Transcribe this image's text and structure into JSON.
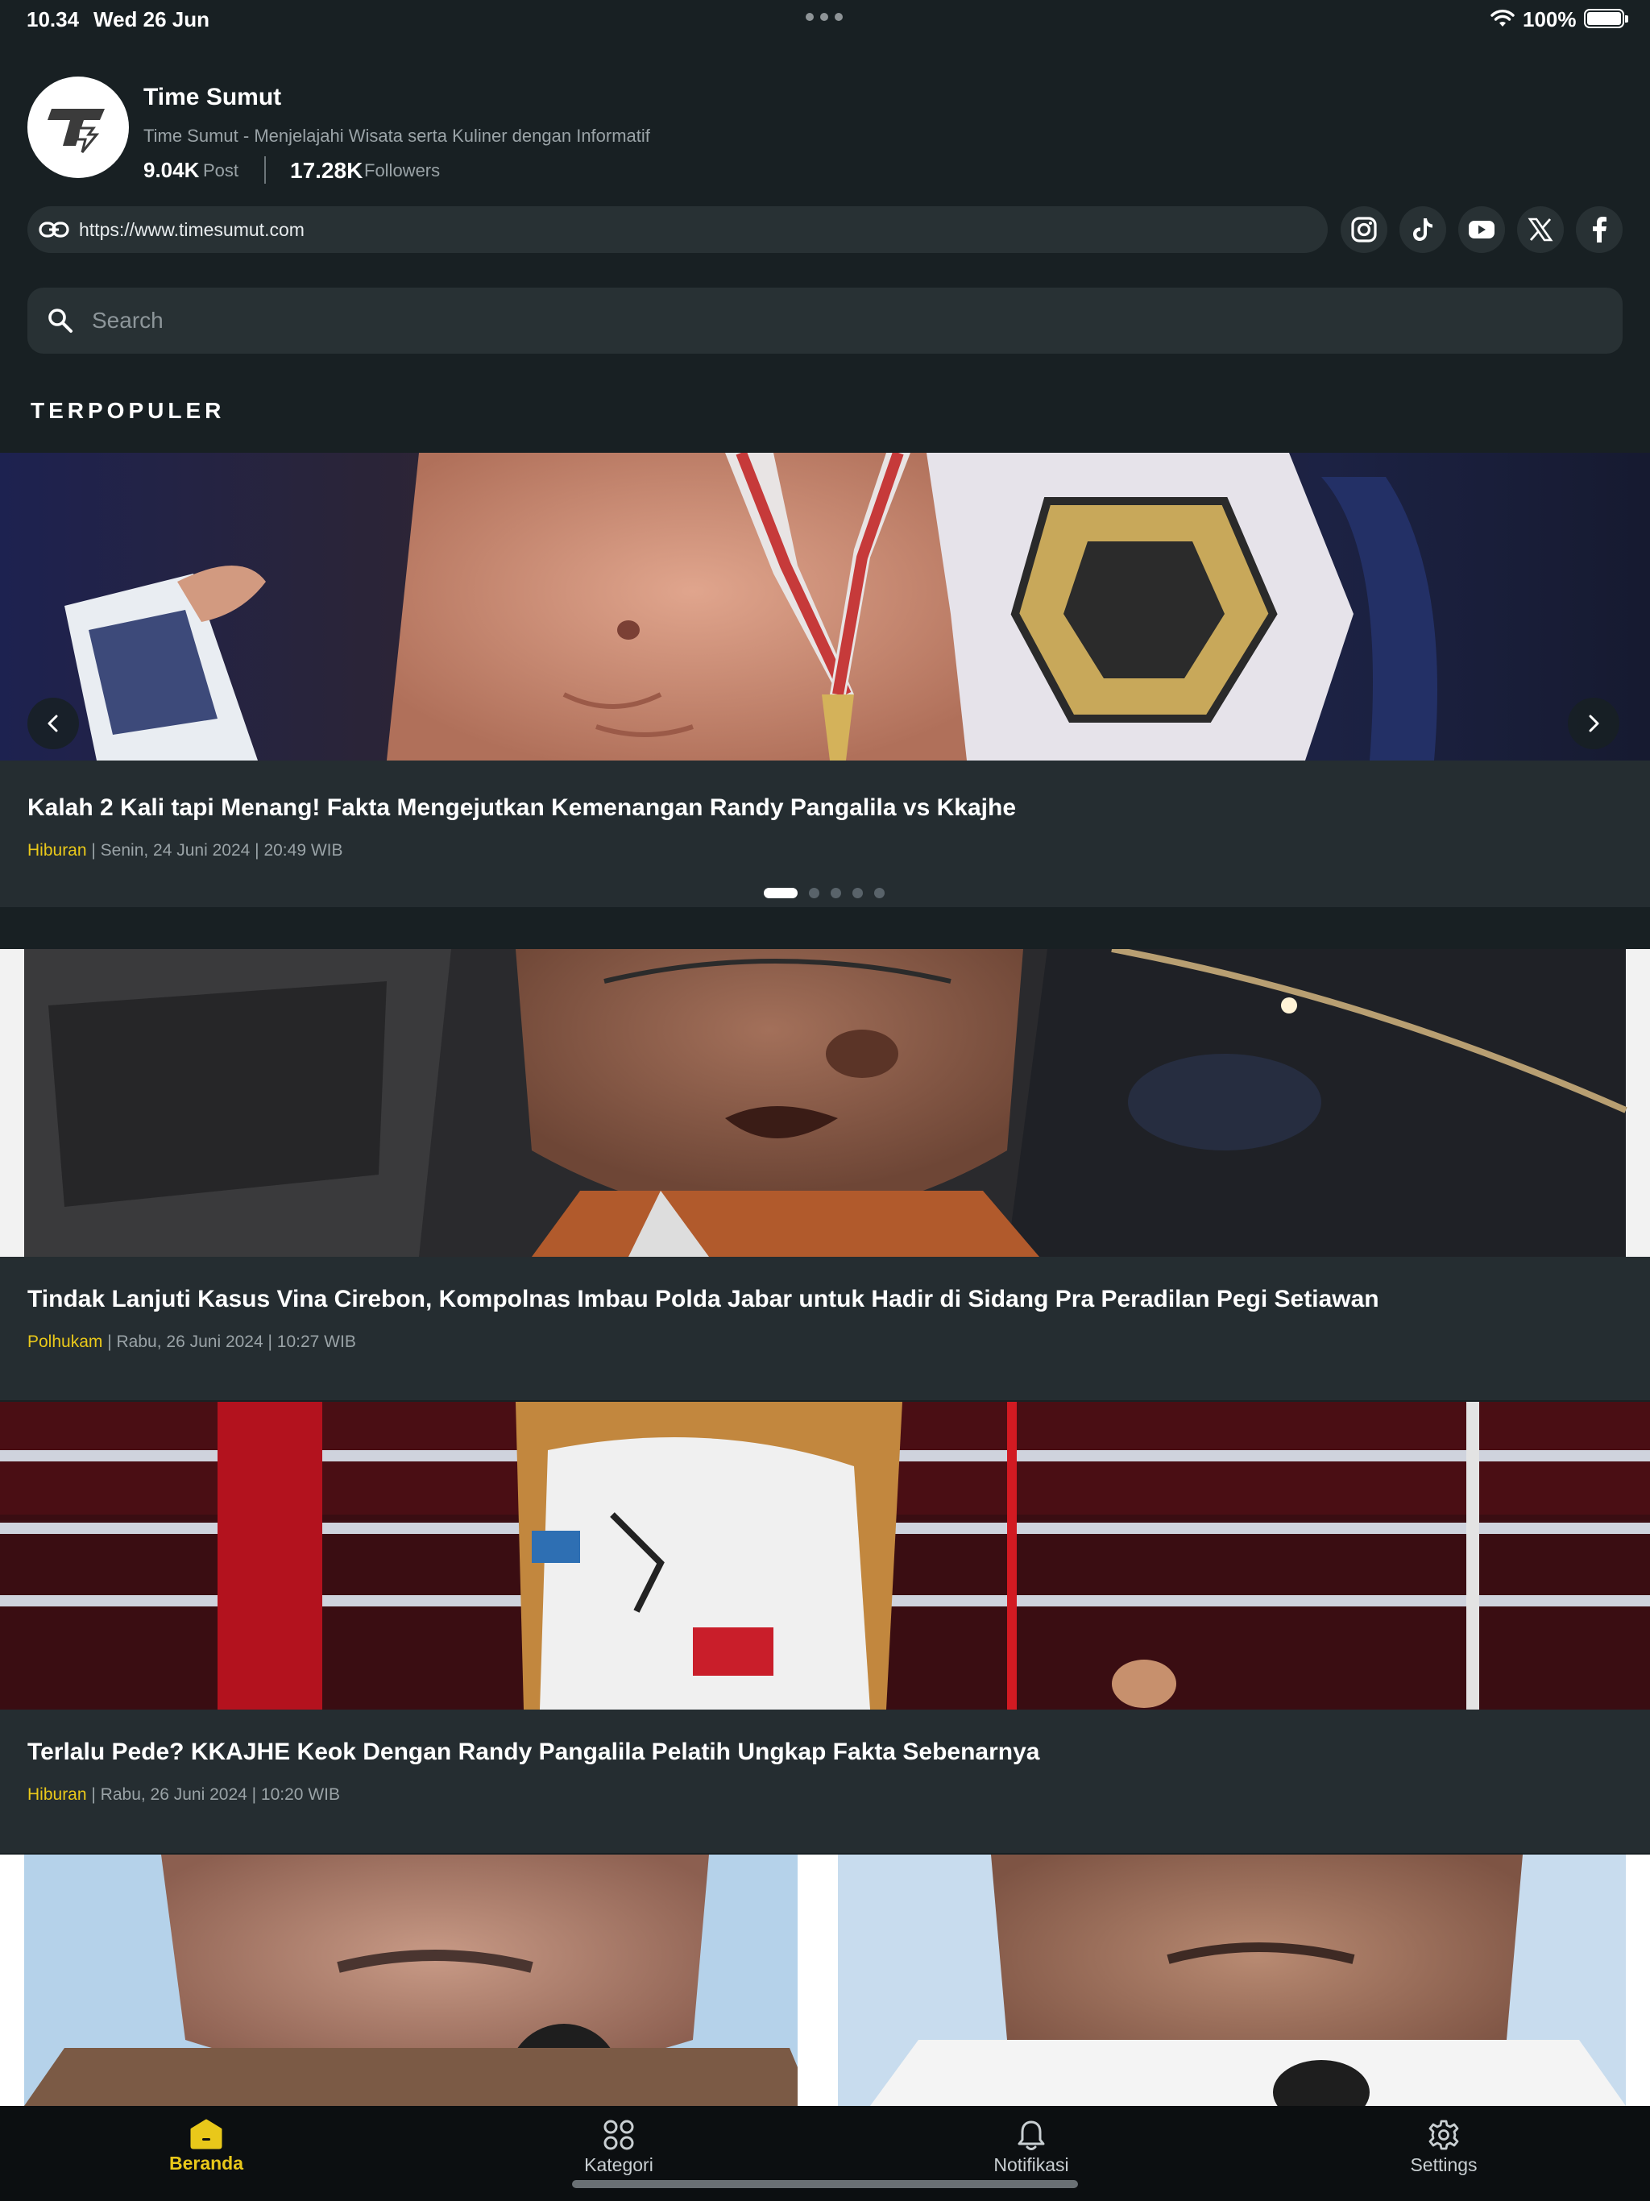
{
  "status_bar": {
    "time": "10.34",
    "date": "Wed 26 Jun",
    "battery": "100%"
  },
  "profile": {
    "name": "Time Sumut",
    "description": "Time Sumut - Menjelajahi Wisata serta Kuliner dengan Informatif",
    "posts_value": "9.04K",
    "posts_label": "Post",
    "followers_value": "17.28K",
    "followers_label": "Followers",
    "url": "https://www.timesumut.com"
  },
  "social_icons": [
    "instagram-icon",
    "tiktok-icon",
    "youtube-icon",
    "x-icon",
    "facebook-icon"
  ],
  "search": {
    "placeholder": "Search"
  },
  "section_title": "TERPOPULER",
  "featured": {
    "title": "Kalah 2 Kali tapi Menang! Fakta Mengejutkan Kemenangan Randy Pangalila vs Kkajhe",
    "category": "Hiburan",
    "date": " | Senin, 24 Juni 2024 | 20:49 WIB",
    "slide_count": 5,
    "active_slide": 1
  },
  "articles": [
    {
      "title": "Tindak Lanjuti Kasus Vina Cirebon, Kompolnas Imbau Polda Jabar untuk Hadir di Sidang Pra Peradilan Pegi Setiawan",
      "category": "Polhukam",
      "date": " | Rabu, 26 Juni 2024 | 10:27 WIB"
    },
    {
      "title": "Terlalu Pede? KKAJHE Keok Dengan Randy Pangalila Pelatih Ungkap Fakta Sebenarnya",
      "category": "Hiburan",
      "date": " | Rabu, 26 Juni 2024 | 10:20 WIB"
    }
  ],
  "tabbar": {
    "home": "Beranda",
    "category": "Kategori",
    "notifications": "Notifikasi",
    "settings": "Settings"
  },
  "colors": {
    "background": "#182023",
    "card": "#252d31",
    "accent": "#e9c81a"
  }
}
